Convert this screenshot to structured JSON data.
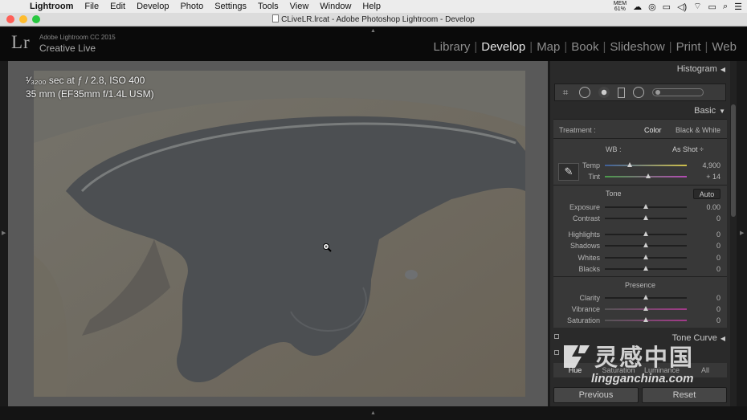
{
  "menubar": {
    "app": "Lightroom",
    "items": [
      "File",
      "Edit",
      "Develop",
      "Photo",
      "Settings",
      "Tools",
      "View",
      "Window",
      "Help"
    ],
    "battery_pct": "61%"
  },
  "window": {
    "title": "CLiveLR.lrcat - Adobe Photoshop Lightroom - Develop"
  },
  "identity": {
    "logo": "Lr",
    "product": "Adobe Lightroom CC 2015",
    "user": "Creative Live"
  },
  "modules": {
    "library": "Library",
    "develop": "Develop",
    "map": "Map",
    "book": "Book",
    "slideshow": "Slideshow",
    "print": "Print",
    "web": "Web",
    "sep": "|"
  },
  "photo_info": {
    "line1": "¹⁄₃₂₀₀ sec at ƒ / 2.8, ISO 400",
    "line2": "35 mm (EF35mm f/1.4L USM)"
  },
  "panels": {
    "histogram": "Histogram",
    "basic": "Basic",
    "tone_curve": "Tone Curve",
    "collapse_glyph": "◀",
    "expand_glyph": "▼"
  },
  "basic": {
    "treatment_label": "Treatment :",
    "color": "Color",
    "bw": "Black & White",
    "wb_label": "WB :",
    "wb_value": "As Shot",
    "wb_arrows": "÷",
    "sliders_wb": [
      {
        "label": "Temp",
        "value": "4,900",
        "pos": 0.3
      },
      {
        "label": "Tint",
        "value": "+ 14",
        "pos": 0.53
      }
    ],
    "tone_label": "Tone",
    "auto": "Auto",
    "sliders_tone": [
      {
        "label": "Exposure",
        "value": "0.00",
        "pos": 0.5
      },
      {
        "label": "Contrast",
        "value": "0",
        "pos": 0.5
      }
    ],
    "sliders_range": [
      {
        "label": "Highlights",
        "value": "0",
        "pos": 0.5
      },
      {
        "label": "Shadows",
        "value": "0",
        "pos": 0.5
      },
      {
        "label": "Whites",
        "value": "0",
        "pos": 0.5
      },
      {
        "label": "Blacks",
        "value": "0",
        "pos": 0.5
      }
    ],
    "presence_label": "Presence",
    "sliders_presence": [
      {
        "label": "Clarity",
        "value": "0",
        "pos": 0.5
      },
      {
        "label": "Vibrance",
        "value": "0",
        "pos": 0.5
      },
      {
        "label": "Saturation",
        "value": "0",
        "pos": 0.5
      }
    ]
  },
  "hsl_tabs": [
    "Hue",
    "Saturation",
    "Luminance",
    "All"
  ],
  "buttons": {
    "previous": "Previous",
    "reset": "Reset"
  },
  "watermark": {
    "cn": "灵感中国",
    "en": "lingganchina.com"
  },
  "colors": {
    "accent_active": "#e6e6e6",
    "panel": "#383838",
    "red_light": "#ff5f57",
    "yellow_light": "#febc2e",
    "green_light": "#28c840"
  }
}
